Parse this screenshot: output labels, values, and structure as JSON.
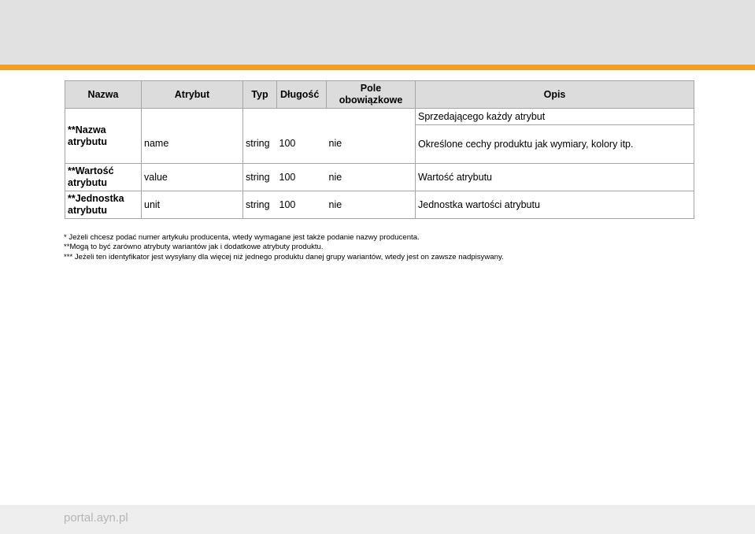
{
  "table": {
    "headers": {
      "nazwa": "Nazwa",
      "atrybut": "Atrybut",
      "typ": "Typ",
      "dlugosc": "Długość",
      "pole_line1": "Pole",
      "pole_line2": "obowiązkowe",
      "opis": "Opis"
    },
    "opis_top": "Sprzedającego każdy atrybut",
    "rows": [
      {
        "name_line1": "**Nazwa",
        "name_line2": "atrybutu",
        "attribute": "name",
        "type": "string",
        "length": "100",
        "required": "nie",
        "description": "Określone cechy produktu jak wymiary, kolory itp."
      },
      {
        "name_line1": "**Wartość",
        "name_line2": "atrybutu",
        "attribute": "value",
        "type": "string",
        "length": "100",
        "required": "nie",
        "description": "Wartość atrybutu"
      },
      {
        "name_line1": "**Jednostka",
        "name_line2": "atrybutu",
        "attribute": "unit",
        "type": "string",
        "length": "100",
        "required": "nie",
        "description": "Jednostka wartości atrybutu"
      }
    ]
  },
  "notes": [
    "* Jeżeli chcesz podać numer artykułu producenta, wtedy wymagane jest także podanie nazwy producenta.",
    "**Mogą to być zarówno atrybuty wariantów jak i dodatkowe atrybuty produktu.",
    "*** Jeżeli ten identyfikator jest wysyłany dla więcej niż jednego produktu danej grupy wariantów, wtedy jest on zawsze nadpisywany."
  ],
  "footer": {
    "site": "portal.ayn.pl"
  },
  "colors": {
    "accent_bar": "#f3a01e",
    "header_bg": "#dcdcdc",
    "top_band": "#e1e1e1"
  }
}
